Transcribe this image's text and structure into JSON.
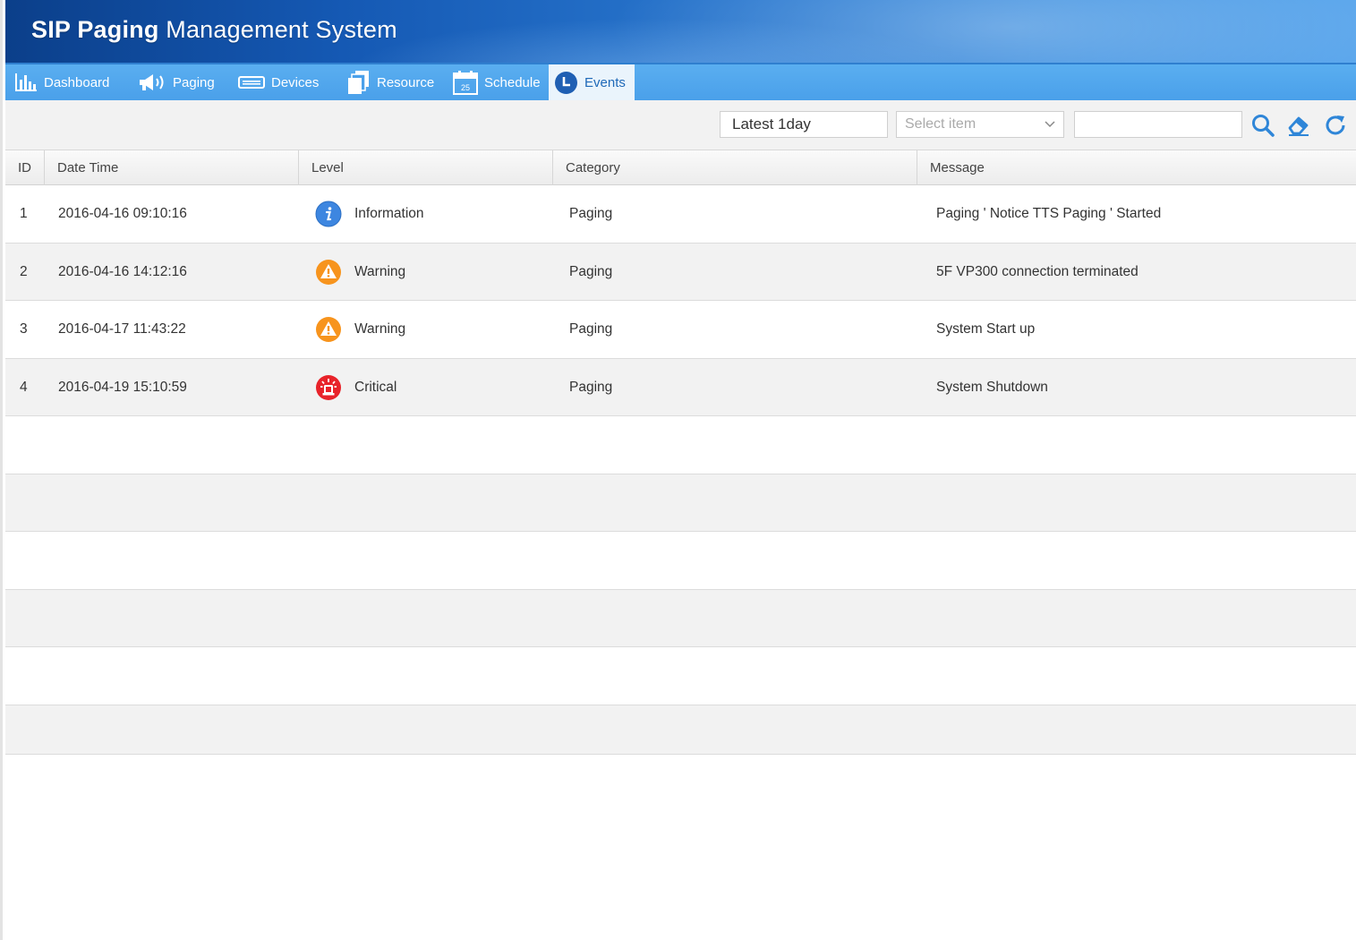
{
  "app": {
    "title_bold": "SIP Paging",
    "title_rest": " Management System"
  },
  "nav": {
    "items": [
      {
        "label": "Dashboard",
        "icon": "bar-chart-icon"
      },
      {
        "label": "Paging",
        "icon": "megaphone-icon"
      },
      {
        "label": "Devices",
        "icon": "device-icon"
      },
      {
        "label": "Resource",
        "icon": "files-icon"
      },
      {
        "label": "Schedule",
        "icon": "calendar-icon"
      },
      {
        "label": "Events",
        "icon": "clock-icon",
        "active": true
      }
    ],
    "calendar_day": "25"
  },
  "toolbar": {
    "period": "Latest 1day",
    "select_placeholder": "Select item",
    "search_value": "",
    "icons": [
      "search-icon",
      "eraser-icon",
      "refresh-icon"
    ]
  },
  "table": {
    "headers": {
      "id": "ID",
      "datetime": "Date Time",
      "level": "Level",
      "category": "Category",
      "message": "Message"
    },
    "rows": [
      {
        "id": "1",
        "datetime": "2016-04-16 09:10:16",
        "level": "Information",
        "level_icon": "info-icon",
        "category": "Paging",
        "message": "Paging ' Notice TTS Paging ' Started"
      },
      {
        "id": "2",
        "datetime": "2016-04-16 14:12:16",
        "level": "Warning",
        "level_icon": "warning-icon",
        "category": "Paging",
        "message": "5F VP300 connection terminated"
      },
      {
        "id": "3",
        "datetime": "2016-04-17 11:43:22",
        "level": "Warning",
        "level_icon": "warning-icon",
        "category": "Paging",
        "message": "System Start up"
      },
      {
        "id": "4",
        "datetime": "2016-04-19 15:10:59",
        "level": "Critical",
        "level_icon": "critical-icon",
        "category": "Paging",
        "message": "System Shutdown"
      }
    ]
  },
  "colors": {
    "header_dark": "#0b3f8a",
    "nav_blue": "#4aa0ea",
    "info": "#3d86e0",
    "warning": "#f7941d",
    "critical": "#e8232a"
  }
}
